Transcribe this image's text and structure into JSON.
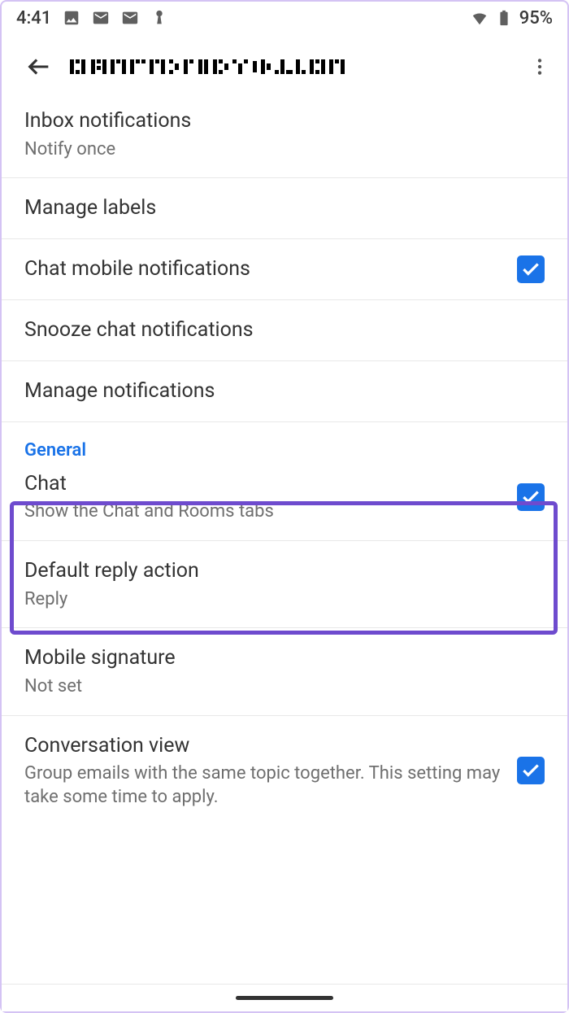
{
  "statusBar": {
    "time": "4:41",
    "battery": "95%"
  },
  "appBar": {
    "title": "parthshah1575@gmail.com"
  },
  "settings": [
    {
      "title": "Inbox notifications",
      "sub": "Notify once",
      "check": null
    },
    {
      "title": "Manage labels",
      "sub": null,
      "check": null
    },
    {
      "title": "Chat mobile notifications",
      "sub": null,
      "check": true
    },
    {
      "title": "Snooze chat notifications",
      "sub": null,
      "check": null
    },
    {
      "title": "Manage notifications",
      "sub": null,
      "check": null
    }
  ],
  "sectionHeader": "General",
  "generalSettings": [
    {
      "title": "Chat",
      "sub": "Show the Chat and Rooms tabs",
      "check": true
    },
    {
      "title": "Default reply action",
      "sub": "Reply",
      "check": null
    },
    {
      "title": "Mobile signature",
      "sub": "Not set",
      "check": null
    },
    {
      "title": "Conversation view",
      "sub": "Group emails with the same topic together. This setting may take some time to apply.",
      "check": true
    }
  ]
}
